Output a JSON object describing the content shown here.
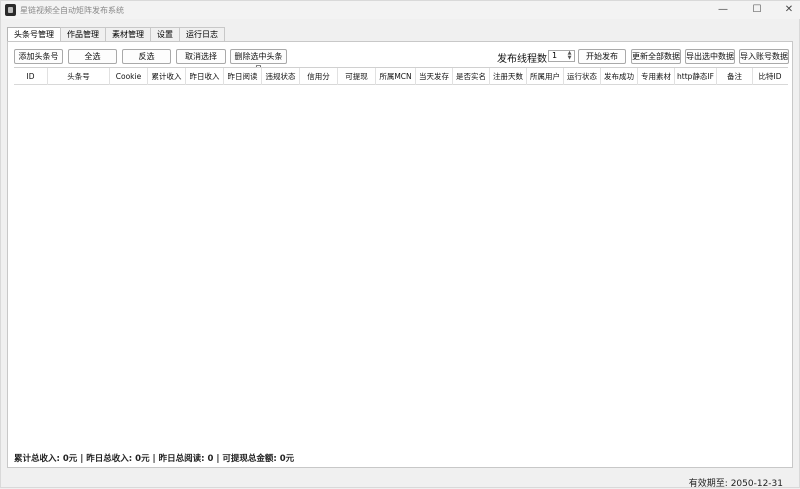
{
  "window": {
    "title": "星链视频全自动矩阵发布系统"
  },
  "tabs": [
    "头条号管理",
    "作品管理",
    "素材管理",
    "设置",
    "运行日志"
  ],
  "toolbar": {
    "add_account": "添加头条号",
    "select_all": "全选",
    "invert": "反选",
    "cancel_select": "取消选择",
    "delete_selected": "删除选中头条号",
    "thread_label": "发布线程数:",
    "thread_value": "1",
    "start_publish": "开始发布",
    "update_all": "更新全部数据",
    "export_selected": "导出选中数据",
    "import_accounts": "导入账号数据"
  },
  "table": {
    "columns": [
      "ID",
      "头条号",
      "Cookie",
      "累计收入",
      "昨日收入",
      "昨日阅读",
      "违规状态",
      "信用分",
      "可提现",
      "所属MCN",
      "当天发存",
      "是否实名",
      "注册天数",
      "所属用户",
      "运行状态",
      "发布成功",
      "专用素材",
      "http静态IF",
      "备注",
      "比特ID"
    ],
    "rows": []
  },
  "summary": "累计总收入: 0元 | 昨日总收入: 0元 | 昨日总阅读: 0 | 可提现总金额: 0元",
  "status": {
    "expiry": "有效期至: 2050-12-31"
  }
}
